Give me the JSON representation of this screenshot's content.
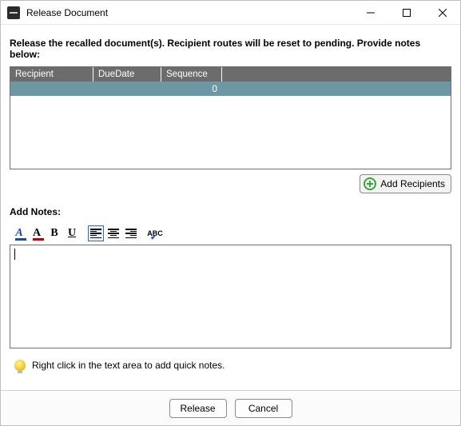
{
  "window": {
    "title": "Release Document"
  },
  "instruction": "Release the recalled document(s). Recipient routes will be reset to pending. Provide notes below:",
  "table": {
    "headers": {
      "col1": "Recipient",
      "col2": "DueDate",
      "col3": "Sequence"
    },
    "rows": [
      {
        "recipient": "",
        "duedate": "",
        "sequence": "0"
      }
    ]
  },
  "buttons": {
    "add_recipients": "Add Recipients",
    "release": "Release",
    "cancel": "Cancel"
  },
  "notes": {
    "label": "Add Notes:",
    "value": ""
  },
  "hint": "Right click in the text area to add quick notes.",
  "icons": {
    "highlight": "A",
    "fontcolor": "A",
    "bold": "B",
    "underline": "U",
    "spell": "ABC"
  }
}
